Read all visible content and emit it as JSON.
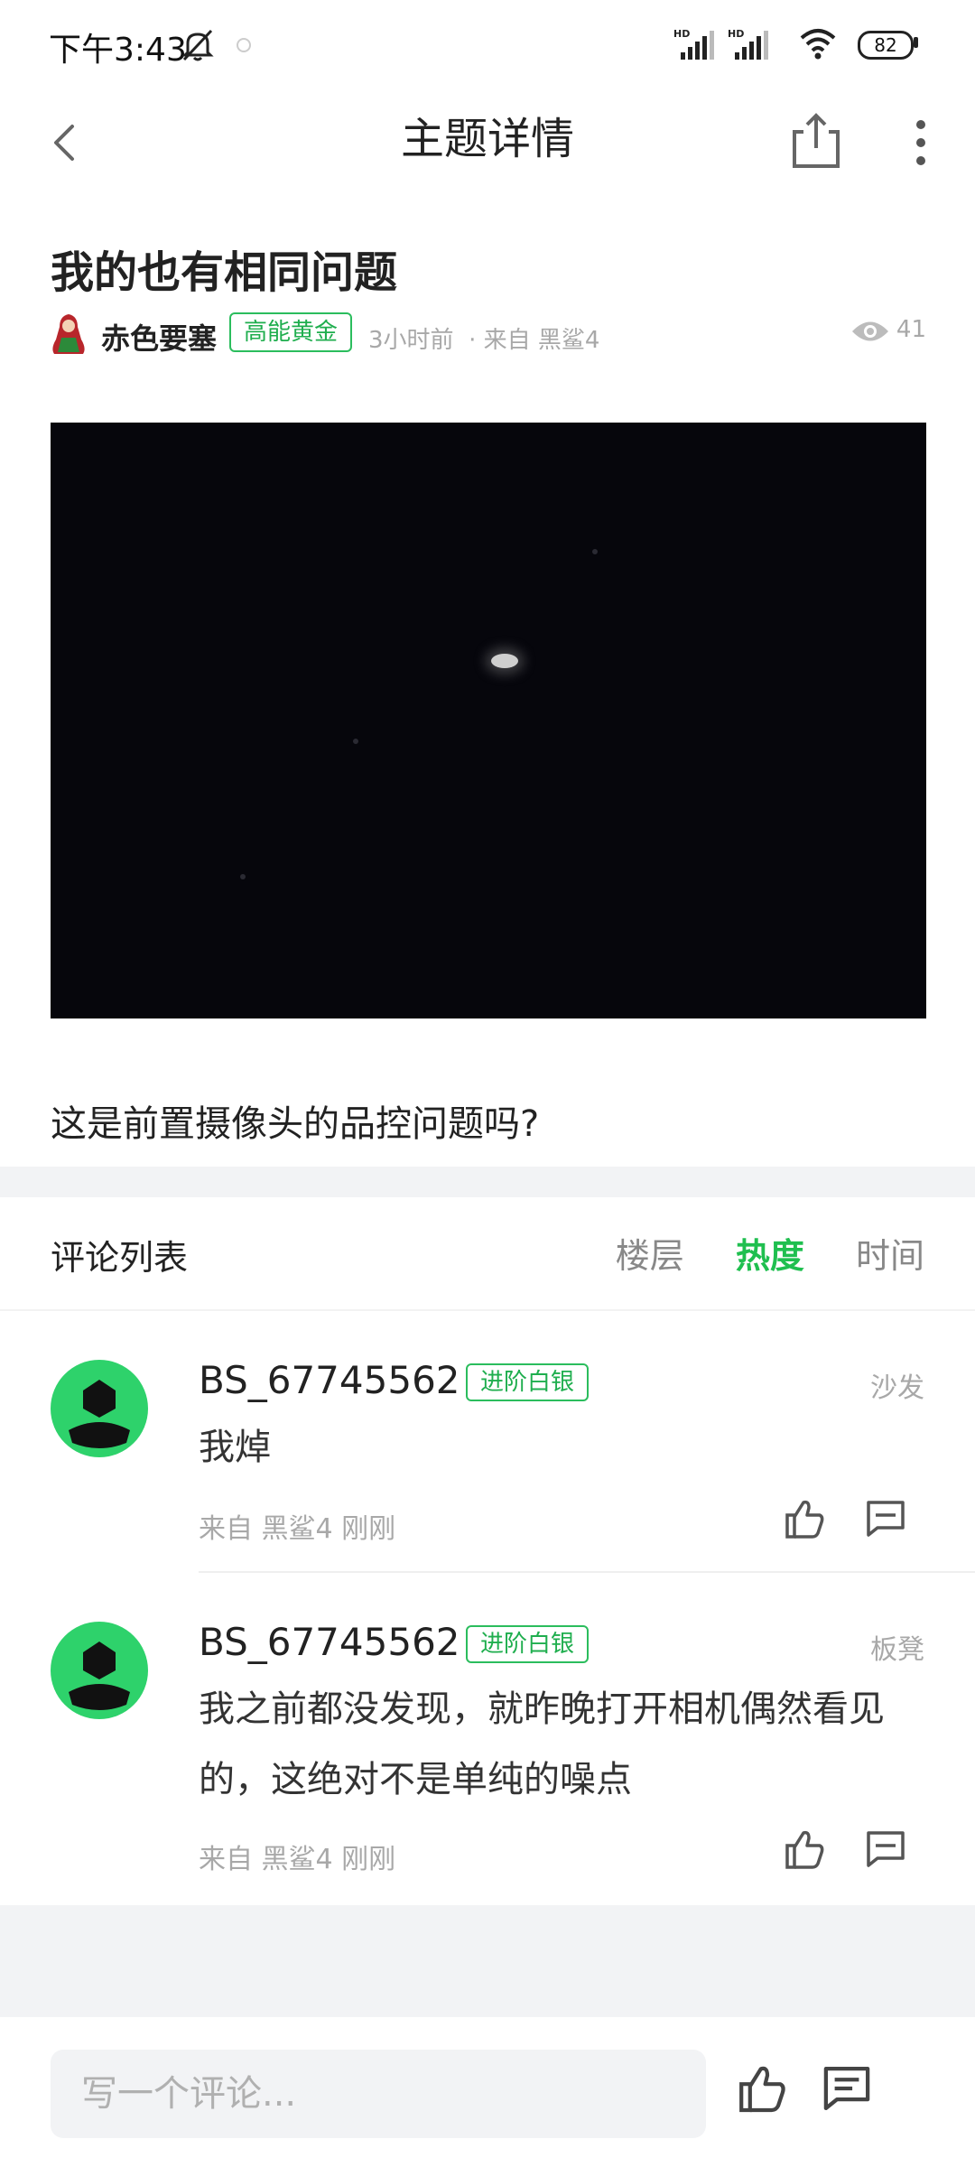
{
  "status_bar": {
    "time": "下午3:43",
    "battery": "82",
    "signal_label_1": "HD",
    "signal_label_2": "HD"
  },
  "header": {
    "title": "主题详情"
  },
  "post": {
    "title": "我的也有相同问题",
    "author": "赤色要塞",
    "rank": "高能黄金",
    "time": "3小时前",
    "source": "· 来自 黑鲨4",
    "views": "41",
    "body": "这是前置摄像头的品控问题吗?"
  },
  "comments_section": {
    "title": "评论列表",
    "sort_tabs": [
      {
        "label": "楼层",
        "active": false
      },
      {
        "label": "热度",
        "active": true
      },
      {
        "label": "时间",
        "active": false
      }
    ]
  },
  "comments": [
    {
      "user": "BS_67745562",
      "rank": "进阶白银",
      "floor": "沙发",
      "text": "我焯",
      "meta": "来自 黑鲨4   刚刚"
    },
    {
      "user": "BS_67745562",
      "rank": "进阶白银",
      "floor": "板凳",
      "text": "我之前都没发现，就昨晚打开相机偶然看见的，这绝对不是单纯的噪点",
      "meta": "来自 黑鲨4   刚刚"
    }
  ],
  "input_bar": {
    "placeholder": "写一个评论..."
  },
  "colors": {
    "accent": "#1fbf4f",
    "avatar_green": "#2ed26b",
    "band": "#f2f3f5"
  }
}
